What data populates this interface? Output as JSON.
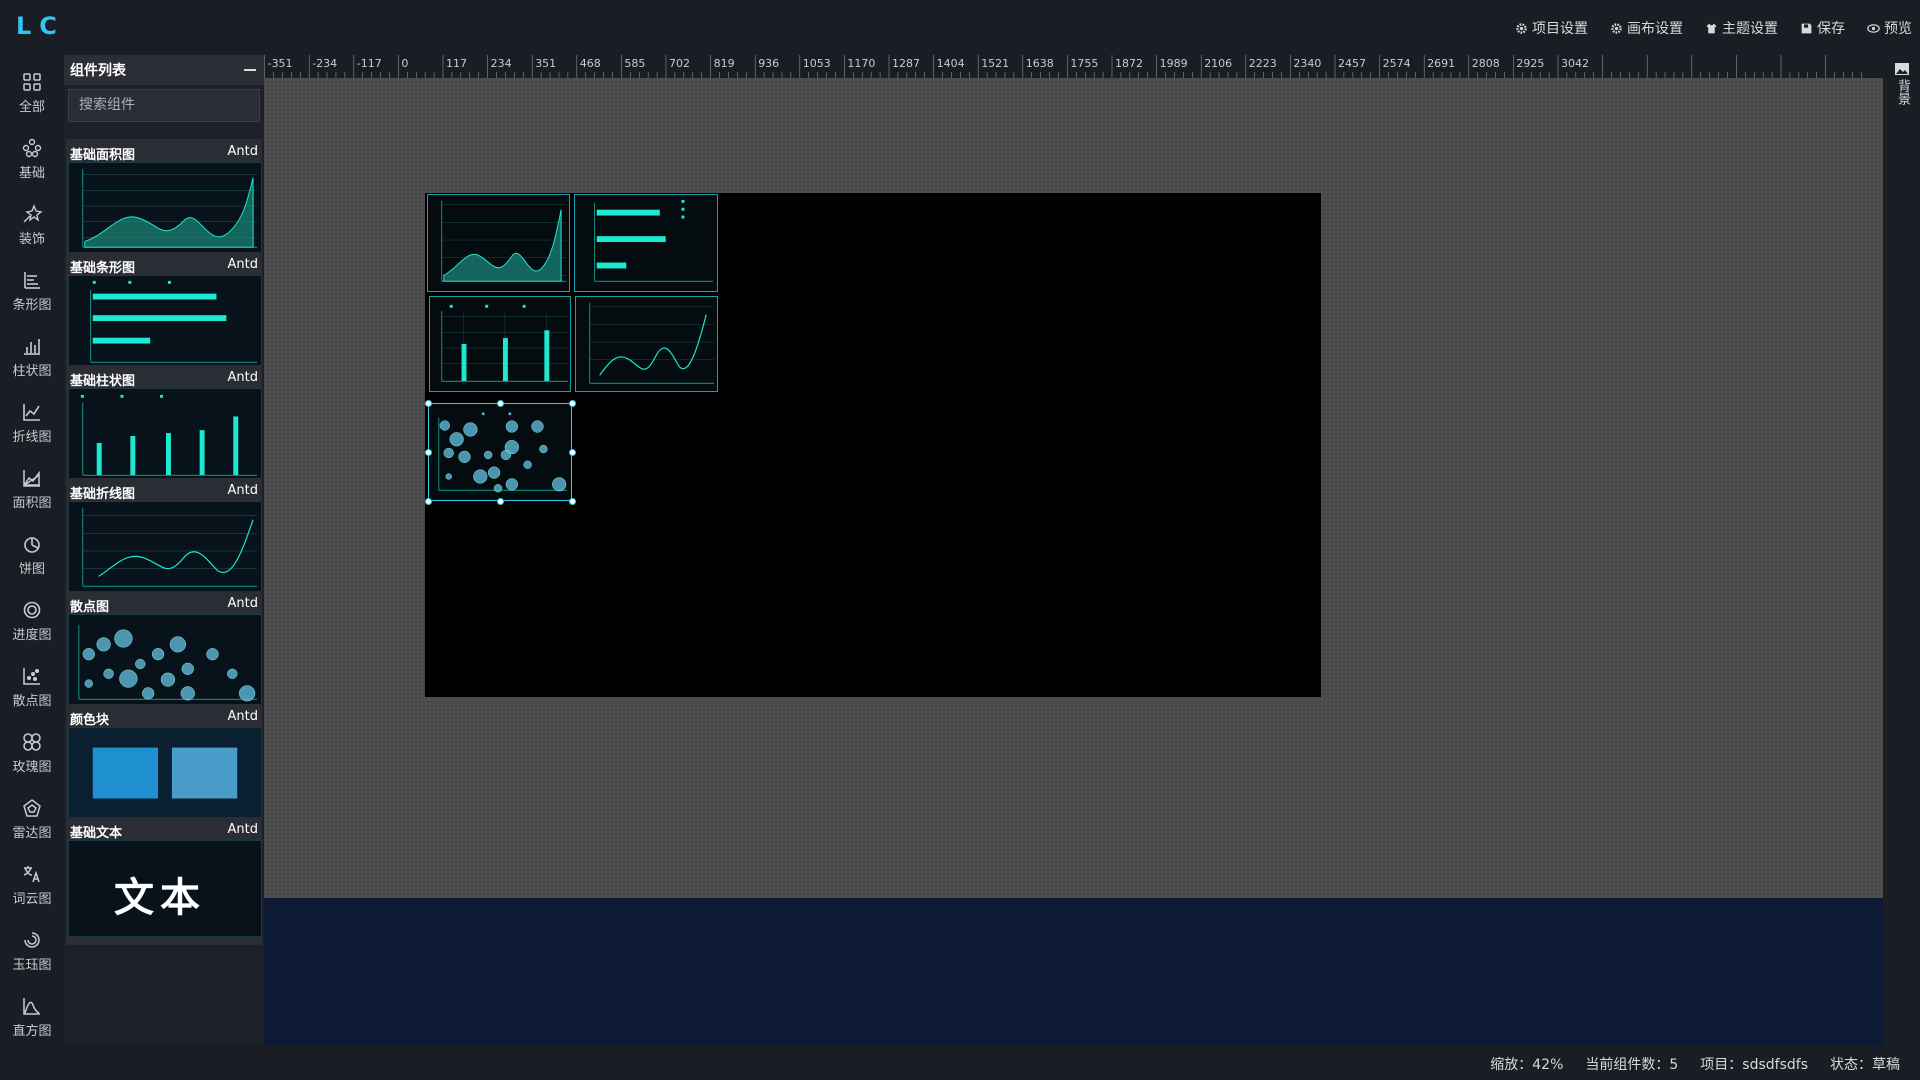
{
  "app": {
    "logo": "LC"
  },
  "header_menu": [
    {
      "label": "项目设置",
      "icon": "gear-icon"
    },
    {
      "label": "画布设置",
      "icon": "gear-icon"
    },
    {
      "label": "主题设置",
      "icon": "shirt-icon"
    },
    {
      "label": "保存",
      "icon": "save-icon"
    },
    {
      "label": "预览",
      "icon": "eye-icon"
    }
  ],
  "rail": [
    {
      "label": "全部",
      "icon": "grid-icon"
    },
    {
      "label": "基础",
      "icon": "basic-icon"
    },
    {
      "label": "装饰",
      "icon": "decoration-icon"
    },
    {
      "label": "条形图",
      "icon": "bar-chart-icon"
    },
    {
      "label": "柱状图",
      "icon": "column-chart-icon"
    },
    {
      "label": "折线图",
      "icon": "line-chart-icon"
    },
    {
      "label": "面积图",
      "icon": "area-chart-icon"
    },
    {
      "label": "饼图",
      "icon": "pie-chart-icon"
    },
    {
      "label": "进度图",
      "icon": "progress-icon"
    },
    {
      "label": "散点图",
      "icon": "scatter-icon"
    },
    {
      "label": "玫瑰图",
      "icon": "rose-icon"
    },
    {
      "label": "雷达图",
      "icon": "radar-icon"
    },
    {
      "label": "词云图",
      "icon": "wordcloud-icon"
    },
    {
      "label": "玉珏图",
      "icon": "ring-icon"
    },
    {
      "label": "直方图",
      "icon": "histogram-icon"
    }
  ],
  "panel": {
    "title": "组件列表",
    "search_placeholder": "搜索组件",
    "cards": [
      {
        "title": "基础面积图",
        "source": "Antd"
      },
      {
        "title": "基础条形图",
        "source": "Antd"
      },
      {
        "title": "基础柱状图",
        "source": "Antd"
      },
      {
        "title": "基础折线图",
        "source": "Antd"
      },
      {
        "title": "散点图",
        "source": "Antd"
      },
      {
        "title": "颜色块",
        "source": "Antd"
      },
      {
        "title": "基础文本",
        "source": "Antd"
      }
    ],
    "text_preview": "文本"
  },
  "ruler": {
    "ticks": [
      "-351",
      "-234",
      "-117",
      "0",
      "117",
      "234",
      "351",
      "468",
      "585",
      "702",
      "819",
      "936",
      "1053",
      "1170",
      "1287",
      "1404",
      "1521",
      "1638",
      "1755",
      "1872",
      "1989",
      "2106",
      "2223",
      "2340",
      "2457",
      "2574",
      "2691",
      "2808",
      "2925",
      "3042"
    ]
  },
  "right_rail": {
    "background_label": "背景",
    "icon": "image-icon"
  },
  "status": {
    "zoom": "缩放：42%",
    "count": "当前组件数：5",
    "project": "项目：sdsdfsdfs",
    "state": "状态：草稿"
  },
  "colors": {
    "accent": "#31c4f5",
    "chart": "#1de9d0",
    "bubble": "#5fb8d8"
  }
}
